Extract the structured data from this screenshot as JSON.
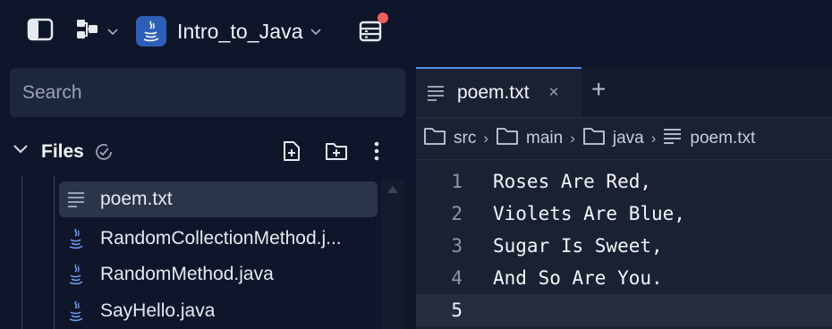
{
  "topbar": {
    "project_name": "Intro_to_Java",
    "layout_icon": "workspace-layout-icon",
    "sidebar_icon": "sidebar-toggle-icon",
    "deploy_icon": "deployments-icon"
  },
  "sidebar": {
    "search_placeholder": "Search",
    "files_label": "Files",
    "files": [
      {
        "name": "poem.txt",
        "icon": "text-file-icon",
        "selected": true
      },
      {
        "name": "RandomCollectionMethod.j...",
        "icon": "java-file-icon",
        "selected": false
      },
      {
        "name": "RandomMethod.java",
        "icon": "java-file-icon",
        "selected": false
      },
      {
        "name": "SayHello.java",
        "icon": "java-file-icon",
        "selected": false
      }
    ]
  },
  "editor": {
    "tab_label": "poem.txt",
    "tab_close": "×",
    "tab_add": "+",
    "breadcrumb": [
      "src",
      "main",
      "java",
      "poem.txt"
    ],
    "lines": [
      {
        "num": "1",
        "text": "Roses Are Red,"
      },
      {
        "num": "2",
        "text": "Violets Are Blue,"
      },
      {
        "num": "3",
        "text": "Sugar Is Sweet,"
      },
      {
        "num": "4",
        "text": "And So Are You."
      },
      {
        "num": "5",
        "text": ""
      }
    ],
    "current_line": 5
  },
  "colors": {
    "background": "#0f1629",
    "accent": "#4f8cf0",
    "notification": "#f25c5c"
  }
}
